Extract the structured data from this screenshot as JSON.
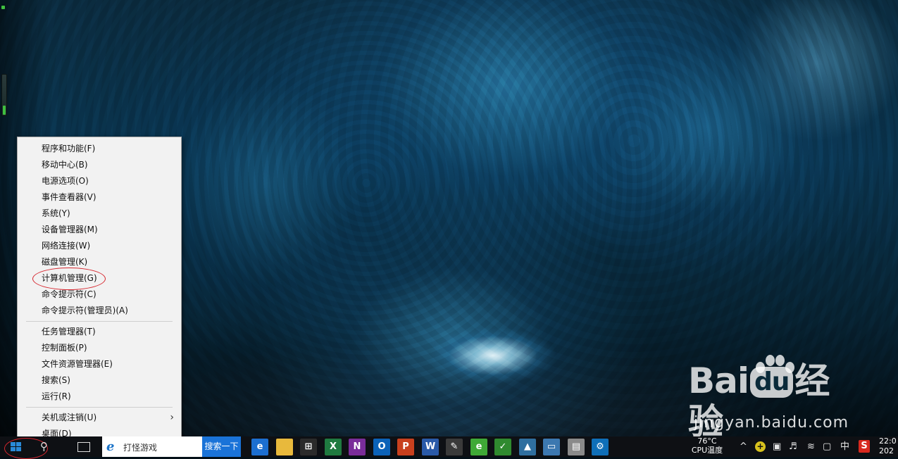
{
  "context_menu": {
    "items": [
      {
        "label": "程序和功能(F)"
      },
      {
        "label": "移动中心(B)"
      },
      {
        "label": "电源选项(O)"
      },
      {
        "label": "事件查看器(V)"
      },
      {
        "label": "系统(Y)"
      },
      {
        "label": "设备管理器(M)"
      },
      {
        "label": "网络连接(W)"
      },
      {
        "label": "磁盘管理(K)"
      },
      {
        "label": "计算机管理(G)"
      },
      {
        "label": "命令提示符(C)"
      },
      {
        "label": "命令提示符(管理员)(A)"
      },
      {
        "label": "任务管理器(T)"
      },
      {
        "label": "控制面板(P)"
      },
      {
        "label": "文件资源管理器(E)"
      },
      {
        "label": "搜索(S)"
      },
      {
        "label": "运行(R)"
      },
      {
        "label": "关机或注销(U)"
      },
      {
        "label": "桌面(D)"
      }
    ],
    "submenu_chevron": "›",
    "highlight_color": "#d6262e"
  },
  "watermark": {
    "logo_pre": "Bai",
    "logo_du": "du",
    "logo_post": "经验",
    "url": "jingyan.baidu.com"
  },
  "taskbar": {
    "ie_search_text": "打怪游戏",
    "search_button": "搜索一下",
    "apps": [
      {
        "name": "edge-icon",
        "glyph": "e",
        "bg": "#1c6fd0"
      },
      {
        "name": "file-explorer-icon",
        "glyph": "",
        "bg": "#e8b93c"
      },
      {
        "name": "store-icon",
        "glyph": "⊞",
        "bg": "#2b2b2b"
      },
      {
        "name": "excel-icon",
        "glyph": "X",
        "bg": "#1f7a40"
      },
      {
        "name": "onenote-icon",
        "glyph": "N",
        "bg": "#7a2d9a"
      },
      {
        "name": "outlook-icon",
        "glyph": "O",
        "bg": "#0b62b8"
      },
      {
        "name": "powerpoint-icon",
        "glyph": "P",
        "bg": "#c8401e"
      },
      {
        "name": "word-icon",
        "glyph": "W",
        "bg": "#2a5aa8"
      },
      {
        "name": "paint-icon",
        "glyph": "✎",
        "bg": "#3a3a3a"
      },
      {
        "name": "browser-360-icon",
        "glyph": "e",
        "bg": "#3fa936"
      },
      {
        "name": "security-shield-icon",
        "glyph": "✓",
        "bg": "#2f8a2f"
      },
      {
        "name": "photo-viewer-icon",
        "glyph": "▲",
        "bg": "#2f6f9f"
      },
      {
        "name": "computer-icon",
        "glyph": "▭",
        "bg": "#3c78b0"
      },
      {
        "name": "printer-icon",
        "glyph": "▤",
        "bg": "#8a8a8a"
      },
      {
        "name": "settings-icon",
        "glyph": "⚙",
        "bg": "#0f6fb8"
      }
    ],
    "cpu_temp": "76°C",
    "cpu_label": "CPU温度",
    "tray": {
      "chevron": "^",
      "ime_label": "中",
      "sogou": "S"
    },
    "clock_time": "22:0",
    "clock_date": "202"
  }
}
